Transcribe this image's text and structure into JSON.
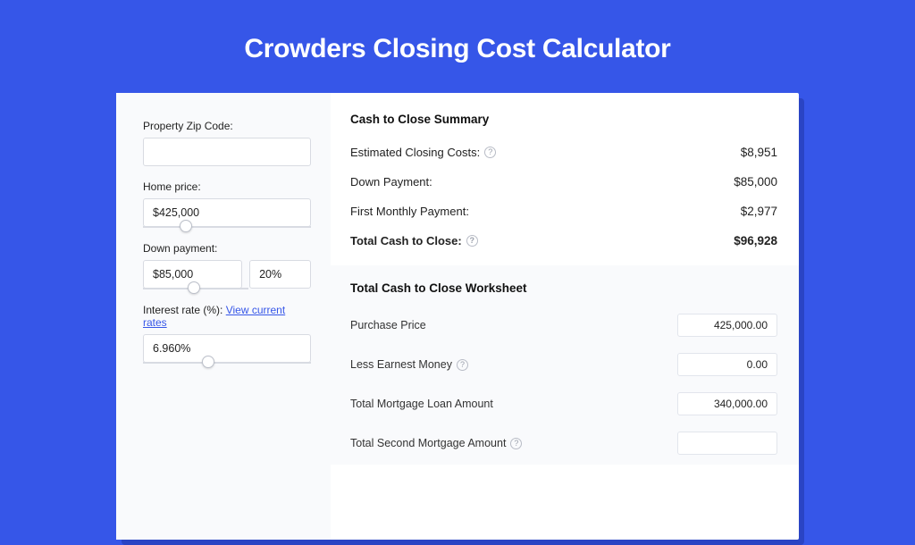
{
  "title": "Crowders Closing Cost Calculator",
  "left": {
    "zip_label": "Property Zip Code:",
    "zip_value": "",
    "price_label": "Home price:",
    "price_value": "$425,000",
    "down_label": "Down payment:",
    "down_value": "$85,000",
    "down_pct": "20%",
    "rate_label": "Interest rate (%):",
    "rate_link": "View current rates",
    "rate_value": "6.960%"
  },
  "summary": {
    "title": "Cash to Close Summary",
    "rows": {
      "est_label": "Estimated Closing Costs:",
      "est_value": "$8,951",
      "dp_label": "Down Payment:",
      "dp_value": "$85,000",
      "fmp_label": "First Monthly Payment:",
      "fmp_value": "$2,977",
      "total_label": "Total Cash to Close:",
      "total_value": "$96,928"
    }
  },
  "worksheet": {
    "title": "Total Cash to Close Worksheet",
    "rows": {
      "pp_label": "Purchase Price",
      "pp_value": "425,000.00",
      "lem_label": "Less Earnest Money",
      "lem_value": "0.00",
      "tmla_label": "Total Mortgage Loan Amount",
      "tmla_value": "340,000.00",
      "tsma_label": "Total Second Mortgage Amount"
    }
  }
}
